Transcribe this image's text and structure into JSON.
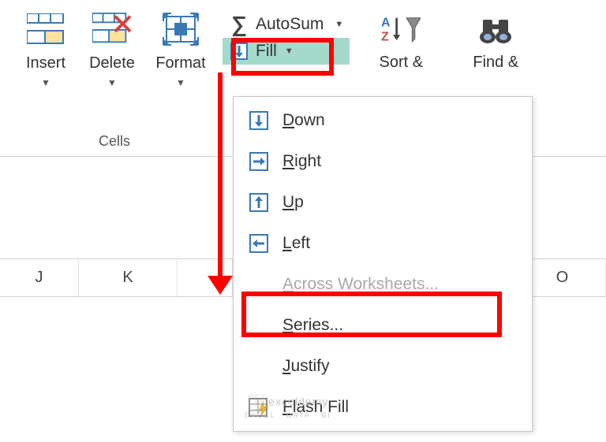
{
  "cells_group": {
    "label": "Cells",
    "insert": "Insert",
    "delete": "Delete",
    "format": "Format"
  },
  "editing": {
    "autosum": "AutoSum",
    "fill": "Fill",
    "sort": "Sort &",
    "find": "Find &"
  },
  "fill_menu": {
    "down": "Down",
    "right": "Right",
    "up": "Up",
    "left": "Left",
    "across": "Across Worksheets...",
    "series": "Series...",
    "justify": "Justify",
    "flash": "Flash Fill"
  },
  "columns": {
    "j": "J",
    "k": "K",
    "o": "O"
  },
  "watermark": {
    "main": "exceldemy",
    "sub": "EXCEL · DATA · BI"
  }
}
